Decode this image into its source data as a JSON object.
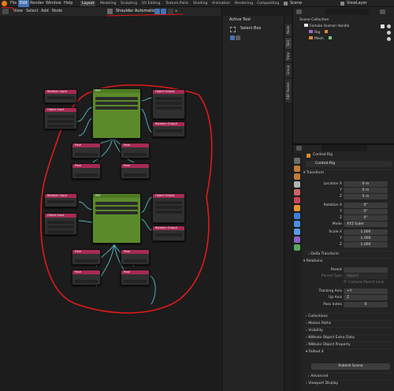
{
  "topbar": {
    "menus": [
      "File",
      "Edit",
      "Render",
      "Window",
      "Help"
    ],
    "workspaces": [
      "Layout",
      "Modeling",
      "Sculpting",
      "UV Editing",
      "Texture Paint",
      "Shading",
      "Animation",
      "Rendering",
      "Compositing"
    ],
    "scene": "Scene",
    "view_layer": "ViewLayer"
  },
  "node_header": {
    "menus": [
      "View",
      "Select",
      "Add",
      "Node"
    ],
    "tree_name": "Shoulder Automation"
  },
  "tool_panel": {
    "title": "Active Tool",
    "tool": "Select Box"
  },
  "side_tabs": [
    "Node",
    "Tool",
    "View",
    "Group",
    "RBF Nodes"
  ],
  "outliner": {
    "scene_collection": "Scene Collection",
    "items": [
      {
        "label": "Female Human Vanilla"
      },
      {
        "label": "Rig"
      },
      {
        "label": "Mesh"
      }
    ]
  },
  "properties": {
    "object": "Control-Rig",
    "object_field": "Control-Rig",
    "transform": {
      "header": "Transform",
      "location": [
        "Location X",
        "Y",
        "Z"
      ],
      "location_values": [
        "0 m",
        "0 m",
        "0 m"
      ],
      "rotation": [
        "Rotation X",
        "Y",
        "Z"
      ],
      "rotation_values": [
        "0°",
        "0°",
        "0°"
      ],
      "mode_label": "Mode",
      "mode": "XYZ Euler",
      "scale": [
        "Scale X",
        "Y",
        "Z"
      ],
      "scale_values": [
        "1.000",
        "1.000",
        "1.000"
      ]
    },
    "delta": "Delta Transform",
    "relations": {
      "header": "Relations",
      "parent": "Parent",
      "parent_type": "Parent Type",
      "parent_type_value": "Object",
      "camera_lock": "Camera Parent Lock",
      "tracking_axis": "Tracking Axis",
      "tracking_axis_value": "+Y",
      "up_axis": "Up Axis",
      "up_axis_value": "Z",
      "pass_index": "Pass Index",
      "pass_index_value": "0"
    },
    "sections": [
      "Collections",
      "Motion Paths",
      "Visibility",
      "NWsolo Object Extra Data",
      "NWsolo Object Property",
      "Fallout 4"
    ],
    "publish": "Publish Scene",
    "bottom_sections": [
      "Advanced",
      "Viewport Display"
    ]
  },
  "nodes": {
    "rbf": "RBF",
    "object_output": "Object Output",
    "object_input": "Object Input",
    "rotation_input": "Rotation Input",
    "rotation_output": "Rotation Output",
    "pose": "Pose"
  },
  "colors": {
    "accent": "#4772b3",
    "node_header_red": "#a62a55",
    "node_green": "#5b8a2a",
    "annotation_red": "#e01a1a",
    "link_cyan": "#5ec8d8"
  }
}
